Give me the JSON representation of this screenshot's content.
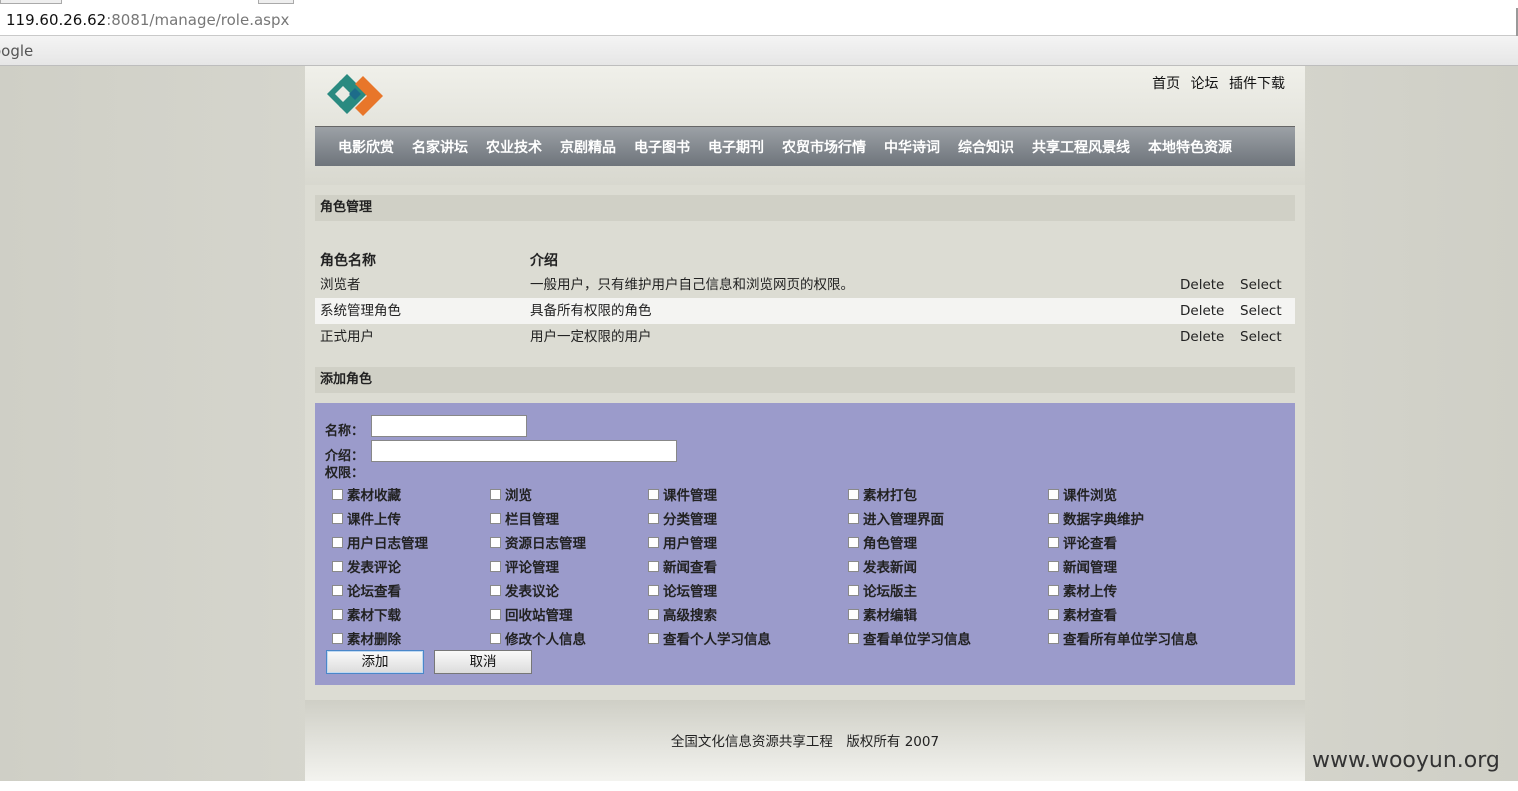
{
  "browser": {
    "url_host": "119.60.26.62",
    "url_rest": ":8081/manage/role.aspx",
    "bookmark": "oogle"
  },
  "header": {
    "top_links": [
      "首页",
      "论坛",
      "插件下载"
    ],
    "nav": [
      "电影欣赏",
      "名家讲坛",
      "农业技术",
      "京剧精品",
      "电子图书",
      "电子期刊",
      "农贸市场行情",
      "中华诗词",
      "综合知识",
      "共享工程风景线",
      "本地特色资源"
    ]
  },
  "roles": {
    "section_title": "角色管理",
    "col_name": "角色名称",
    "col_desc": "介绍",
    "delete_label": "Delete",
    "select_label": "Select",
    "rows": [
      {
        "name": "浏览者",
        "desc": "一般用户，只有维护用户自己信息和浏览网页的权限。"
      },
      {
        "name": "系统管理角色",
        "desc": "具备所有权限的角色"
      },
      {
        "name": "正式用户",
        "desc": "用户一定权限的用户"
      }
    ]
  },
  "add_role": {
    "section_title": "添加角色",
    "name_label": "名称：",
    "desc_label": "介绍：",
    "perm_label": "权限：",
    "name_value": "",
    "desc_value": "",
    "permissions": [
      "素材收藏",
      "浏览",
      "课件管理",
      "素材打包",
      "课件浏览",
      "课件上传",
      "栏目管理",
      "分类管理",
      "进入管理界面",
      "数据字典维护",
      "用户日志管理",
      "资源日志管理",
      "用户管理",
      "角色管理",
      "评论查看",
      "发表评论",
      "评论管理",
      "新闻查看",
      "发表新闻",
      "新闻管理",
      "论坛查看",
      "发表议论",
      "论坛管理",
      "论坛版主",
      "素材上传",
      "素材下载",
      "回收站管理",
      "高级搜索",
      "素材编辑",
      "素材查看",
      "素材删除",
      "修改个人信息",
      "查看个人学习信息",
      "查看单位学习信息",
      "查看所有单位学习信息"
    ],
    "add_button": "添加",
    "cancel_button": "取消"
  },
  "footer": {
    "text": "全国文化信息资源共享工程　版权所有  2007"
  },
  "watermark": "www.wooyun.org"
}
